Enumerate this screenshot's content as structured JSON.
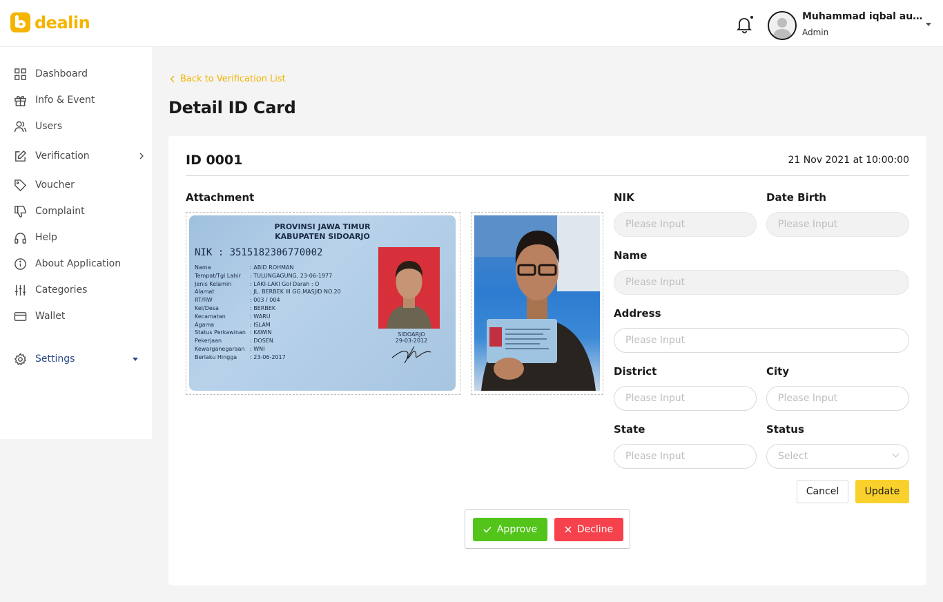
{
  "brand": {
    "name": "dealin",
    "color": "#f5b400"
  },
  "user": {
    "name": "Muhammad iqbal aulia...",
    "role": "Admin"
  },
  "sidebar": {
    "items": [
      {
        "label": "Dashboard",
        "icon": "grid-icon"
      },
      {
        "label": "Info & Event",
        "icon": "gift-icon"
      },
      {
        "label": "Users",
        "icon": "users-icon"
      },
      {
        "label": "Verification",
        "icon": "edit-icon"
      },
      {
        "label": "Voucher",
        "icon": "tag-icon"
      },
      {
        "label": "Complaint",
        "icon": "thumbs-down-icon"
      },
      {
        "label": "Help",
        "icon": "headphones-icon"
      },
      {
        "label": "About Application",
        "icon": "info-icon"
      },
      {
        "label": "Categories",
        "icon": "sliders-icon"
      },
      {
        "label": "Wallet",
        "icon": "credit-card-icon"
      },
      {
        "label": "Settings",
        "icon": "gear-icon"
      }
    ]
  },
  "page": {
    "back_label": "Back to Verification List",
    "title": "Detail ID Card"
  },
  "card": {
    "id": "ID 0001",
    "date": "21 Nov 2021 at 10:00:00",
    "attachment_label": "Attachment",
    "ktp": {
      "province": "PROVINSI JAWA TIMUR",
      "regency": "KABUPATEN SIDOARJO",
      "nik": "NIK    : 3515182306770002",
      "rows": [
        {
          "k": "Nama",
          "v": ": ABID ROHMAN"
        },
        {
          "k": "Tempat/Tgl Lahir",
          "v": ": TULUNGAGUNG, 23-06-1977"
        },
        {
          "k": "Jenis Kelamin",
          "v": ": LAKI-LAKI        Gol Darah  : O"
        },
        {
          "k": "Alamat",
          "v": ": JL. BERBEK III GG.MASJID NO.20"
        },
        {
          "k": "   RT/RW",
          "v": ": 003 / 004"
        },
        {
          "k": "   Kel/Desa",
          "v": ": BERBEK"
        },
        {
          "k": "   Kecamatan",
          "v": ": WARU"
        },
        {
          "k": "Agama",
          "v": ": ISLAM"
        },
        {
          "k": "Status Perkawinan",
          "v": ": KAWIN"
        },
        {
          "k": "Pekerjaan",
          "v": ": DOSEN"
        },
        {
          "k": "Kewarganegaraan",
          "v": ": WNI"
        },
        {
          "k": "Berlaku Hingga",
          "v": ": 23-06-2017"
        }
      ],
      "sign_place": "SIDOARJO",
      "sign_date": "29-03-2012"
    }
  },
  "form": {
    "nik": {
      "label": "NIK",
      "placeholder": "Please Input"
    },
    "date_birth": {
      "label": "Date Birth",
      "placeholder": "Please Input"
    },
    "name": {
      "label": "Name",
      "placeholder": "Please Input"
    },
    "address": {
      "label": "Address",
      "placeholder": "Please Input"
    },
    "district": {
      "label": "District",
      "placeholder": "Please Input"
    },
    "city": {
      "label": "City",
      "placeholder": "Please Input"
    },
    "state": {
      "label": "State",
      "placeholder": "Please Input"
    },
    "status": {
      "label": "Status",
      "placeholder": "Select"
    },
    "cancel_label": "Cancel",
    "update_label": "Update"
  },
  "actions": {
    "approve_label": "Approve",
    "decline_label": "Decline"
  },
  "colors": {
    "accent": "#fad02c",
    "approve": "#52c41a",
    "decline": "#f5424d",
    "link": "#f0b400",
    "settings": "#2c4a8a"
  }
}
